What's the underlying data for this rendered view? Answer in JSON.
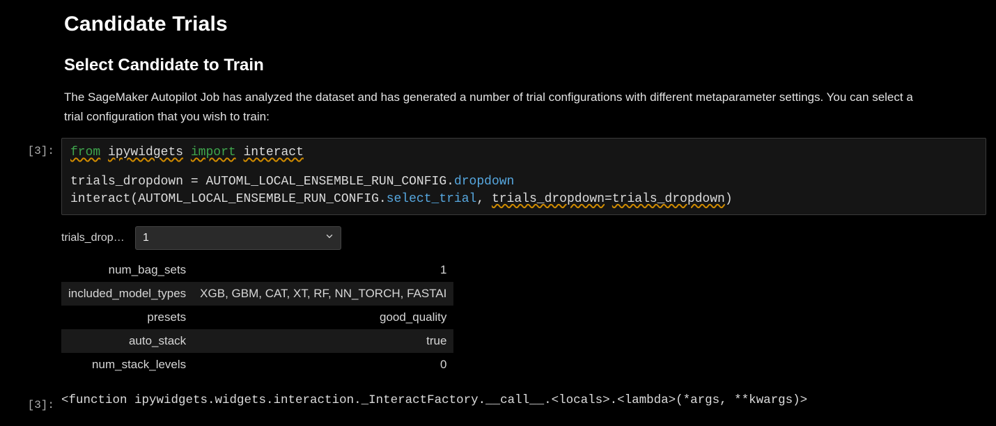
{
  "markdown": {
    "title": "Candidate Trials",
    "subtitle": "Select Candidate to Train",
    "description": "The SageMaker Autopilot Job has analyzed the dataset and has generated a number of trial configurations with different metaparameter settings. You can select a trial configuration that you wish to train:"
  },
  "cell": {
    "in_prompt": "[3]:",
    "out_prompt": "[3]:",
    "code": {
      "line1": {
        "kw_from": "from",
        "mod": "ipywidgets",
        "kw_import": "import",
        "name": "interact"
      },
      "line2": {
        "lhs": "trials_dropdown",
        "eq": "=",
        "obj": "AUTOML_LOCAL_ENSEMBLE_RUN_CONFIG",
        "dot": ".",
        "attr": "dropdown"
      },
      "line3": {
        "fn": "interact",
        "open": "(",
        "obj": "AUTOML_LOCAL_ENSEMBLE_RUN_CONFIG",
        "dot": ".",
        "attr": "select_trial",
        "comma": ",",
        "kw": "trials_dropdown",
        "eq": "=",
        "rhs": "trials_dropdown",
        "close": ")"
      }
    }
  },
  "widget": {
    "dropdown": {
      "label": "trials_drop…",
      "value": "1"
    },
    "params": [
      {
        "key": "num_bag_sets",
        "value": "1"
      },
      {
        "key": "included_model_types",
        "value": "XGB, GBM, CAT, XT, RF, NN_TORCH, FASTAI"
      },
      {
        "key": "presets",
        "value": "good_quality"
      },
      {
        "key": "auto_stack",
        "value": "true"
      },
      {
        "key": "num_stack_levels",
        "value": "0"
      }
    ]
  },
  "output": {
    "repr": "<function ipywidgets.widgets.interaction._InteractFactory.__call__.<locals>.<lambda>(*args, **kwargs)>"
  }
}
